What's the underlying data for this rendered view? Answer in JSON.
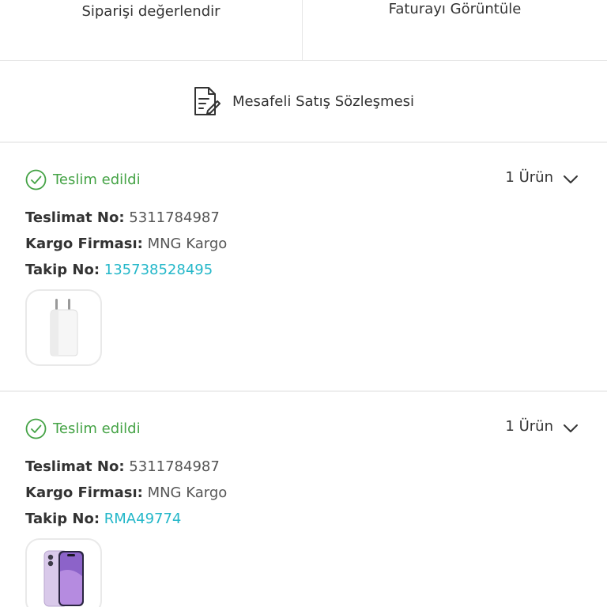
{
  "top_actions": {
    "rate_order": "Siparişi değerlendir",
    "view_invoice": "Faturayı Görüntüle"
  },
  "contract": {
    "label": "Mesafeli Satış Sözleşmesi",
    "icon": "document-edit-icon"
  },
  "shipments": [
    {
      "status": "Teslim edildi",
      "item_count": "1 Ürün",
      "delivery_no_label": "Teslimat No:",
      "delivery_no": "5311784987",
      "carrier_label": "Kargo Firması:",
      "carrier": "MNG Kargo",
      "tracking_label": "Takip No:",
      "tracking_no": "135738528495",
      "product_icon": "power-adapter"
    },
    {
      "status": "Teslim edildi",
      "item_count": "1 Ürün",
      "delivery_no_label": "Teslimat No:",
      "delivery_no": "5311784987",
      "carrier_label": "Kargo Firması:",
      "carrier": "MNG Kargo",
      "tracking_label": "Takip No:",
      "tracking_no": "RMA49774",
      "product_icon": "purple-phone"
    }
  ],
  "colors": {
    "status_green": "#45a346",
    "link_cyan": "#23b7c9",
    "divider": "#eeeeee"
  }
}
